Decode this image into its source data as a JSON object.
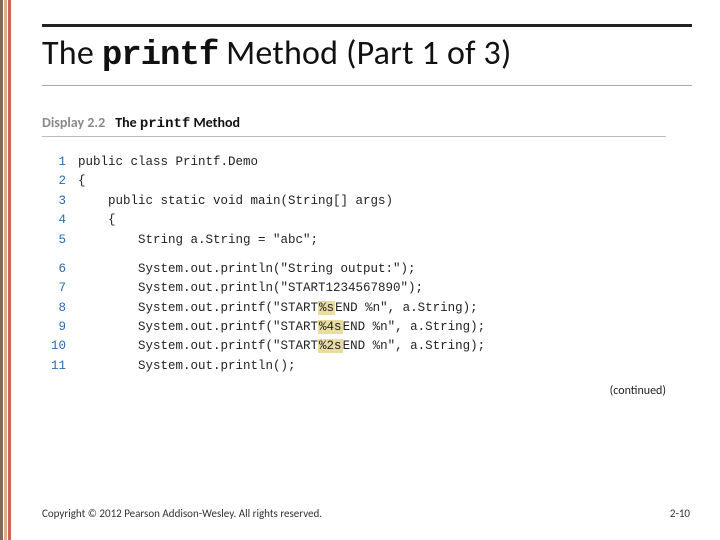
{
  "title": {
    "pre": "The ",
    "code": "printf",
    "post": " Method (Part 1 of 3)"
  },
  "display": {
    "label": "Display 2.2",
    "title_pre": "The ",
    "title_code": "printf",
    "title_post": " Method"
  },
  "code": {
    "lines": [
      {
        "n": "1",
        "text": "public class Printf.Demo"
      },
      {
        "n": "2",
        "text": "{"
      },
      {
        "n": "3",
        "text": "    public static void main(String[] args)"
      },
      {
        "n": "4",
        "text": "    {"
      },
      {
        "n": "5",
        "text": "        String a.String = \"abc\";"
      }
    ],
    "lines2": [
      {
        "n": "6",
        "pre": "        System.out.println(\"String output:\");",
        "hl": "",
        "post": ""
      },
      {
        "n": "7",
        "pre": "        System.out.println(\"START1234567890\");",
        "hl": "",
        "post": ""
      },
      {
        "n": "8",
        "pre": "        System.out.printf(\"START",
        "hl": "%s",
        "post": "END %n\", a.String);"
      },
      {
        "n": "9",
        "pre": "        System.out.printf(\"START",
        "hl": "%4s",
        "post": "END %n\", a.String);"
      },
      {
        "n": "10",
        "pre": "        System.out.printf(\"START",
        "hl": "%2s",
        "post": "END %n\", a.String);"
      },
      {
        "n": "11",
        "pre": "        System.out.println();",
        "hl": "",
        "post": ""
      }
    ]
  },
  "continued": "(continued)",
  "footer": {
    "copyright": "Copyright © 2012 Pearson Addison-Wesley. All rights reserved.",
    "pageno": "2-10"
  }
}
